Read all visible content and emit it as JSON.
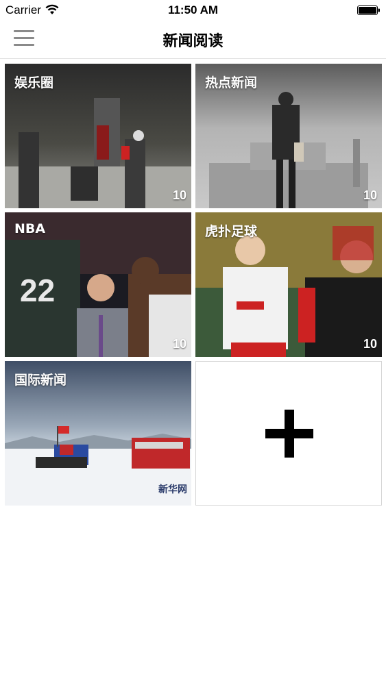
{
  "status_bar": {
    "carrier": "Carrier",
    "time": "11:50 AM",
    "wifi_icon": "wifi-icon",
    "battery_icon": "battery-full-icon"
  },
  "nav": {
    "title": "新闻阅读",
    "menu_icon": "hamburger-menu-icon"
  },
  "tiles": [
    {
      "title": "娱乐圈",
      "count": "10"
    },
    {
      "title": "热点新闻",
      "count": "10"
    },
    {
      "title": "NBA",
      "count": "10"
    },
    {
      "title": "虎扑足球",
      "count": "10"
    },
    {
      "title": "国际新闻"
    }
  ],
  "add_tile": {
    "icon": "plus-icon"
  },
  "colors": {
    "nav_divider": "#e2e2e2",
    "menu_icon": "#8a8a8a",
    "tile_text": "#ffffff",
    "add_tile_border": "#d4d4d4"
  }
}
